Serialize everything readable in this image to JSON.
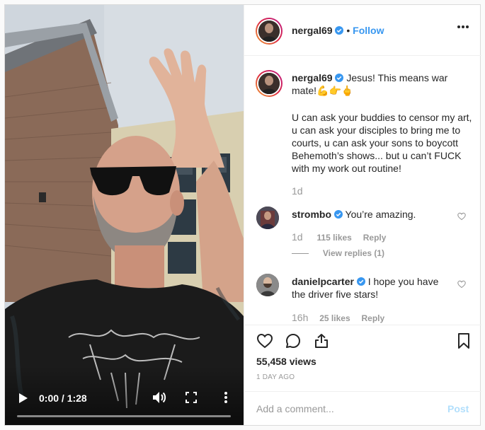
{
  "post": {
    "author": {
      "username": "nergal69",
      "verified": true,
      "follow_label": "Follow",
      "separator": "•"
    },
    "caption": {
      "username": "nergal69",
      "line1": "Jesus! This means war mate!💪👉🖕",
      "body": "U can ask your buddies to censor my art, u can ask your disciples to bring me to courts, u can ask your sons to boycott Behemoth’s shows... but u can’t FUCK with my work out routine!",
      "age": "1d"
    },
    "comments": [
      {
        "username": "strombo",
        "verified": true,
        "text": "You’re amazing.",
        "age": "1d",
        "likes": "115 likes",
        "reply_label": "Reply",
        "view_replies": "View replies (1)"
      },
      {
        "username": "danielpcarter",
        "verified": true,
        "text": "I hope you have the driver five stars!",
        "age": "16h",
        "likes": "25 likes",
        "reply_label": "Reply"
      }
    ],
    "views": "55,458 views",
    "date": "1 DAY AGO",
    "add_comment_placeholder": "Add a comment...",
    "post_label": "Post"
  },
  "video": {
    "timecode": "0:00 / 1:28",
    "progress_fraction": 0.0
  },
  "icons": {
    "play": "play-icon",
    "volume": "volume-icon",
    "fullscreen": "fullscreen-icon",
    "more_vertical": "more-vertical-icon",
    "more_horizontal": "more-horizontal-icon",
    "like": "heart-icon",
    "comment": "comment-icon",
    "share": "share-icon",
    "save": "bookmark-icon",
    "verified": "verified-badge-icon"
  },
  "colors": {
    "link_blue": "#3897f0",
    "post_disabled": "#b2dffc",
    "muted": "#999999",
    "text": "#262626"
  }
}
